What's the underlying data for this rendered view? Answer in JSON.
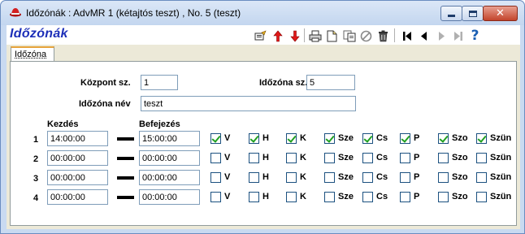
{
  "window": {
    "title": "Időzónák : AdvMR 1 (kétajtós teszt) , No. 5 (teszt)"
  },
  "header": {
    "form_title": "Időzónák"
  },
  "toolbar": {
    "icons": [
      "edit-icon",
      "arrow-up-icon",
      "arrow-down-icon",
      "print-icon",
      "new-document-icon",
      "copy-document-icon",
      "cancel-icon",
      "delete-icon",
      "first-record-icon",
      "previous-record-icon",
      "next-record-icon",
      "last-record-icon",
      "help-icon"
    ]
  },
  "tab": {
    "label": "Időzóna"
  },
  "form": {
    "kozpont_label": "Központ sz.",
    "kozpont_value": "1",
    "idozona_sz_label": "Időzóna sz.",
    "idozona_sz_value": "5",
    "idozona_nev_label": "Időzóna név",
    "idozona_nev_value": "teszt",
    "kezdes_header": "Kezdés",
    "befejezes_header": "Befejezés"
  },
  "days": [
    "V",
    "H",
    "K",
    "Sze",
    "Cs",
    "P",
    "Szo",
    "Szün"
  ],
  "rows": [
    {
      "num": "1",
      "start": "14:00:00",
      "end": "15:00:00",
      "checked": [
        true,
        true,
        true,
        true,
        true,
        true,
        true,
        true
      ]
    },
    {
      "num": "2",
      "start": "00:00:00",
      "end": "00:00:00",
      "checked": [
        false,
        false,
        false,
        false,
        false,
        false,
        false,
        false
      ]
    },
    {
      "num": "3",
      "start": "00:00:00",
      "end": "00:00:00",
      "checked": [
        false,
        false,
        false,
        false,
        false,
        false,
        false,
        false
      ]
    },
    {
      "num": "4",
      "start": "00:00:00",
      "end": "00:00:00",
      "checked": [
        false,
        false,
        false,
        false,
        false,
        false,
        false,
        false
      ]
    }
  ],
  "colors": {
    "title_blue": "#1d2fb8",
    "check_green": "#21a121",
    "tab_accent": "#e6a33a"
  }
}
